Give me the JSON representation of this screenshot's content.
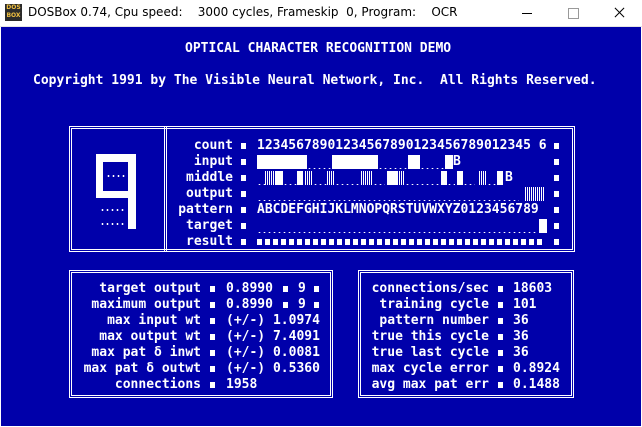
{
  "window": {
    "title": "DOSBox 0.74, Cpu speed:    3000 cycles, Frameskip  0, Program:    OCR",
    "icon_text": "DOS BOX"
  },
  "header": {
    "title": "OPTICAL CHARACTER RECOGNITION DEMO",
    "copyright": "Copyright 1991 by The Visible Neural Network, Inc.  All Rights Reserved."
  },
  "network": {
    "labels": [
      "count",
      "input",
      "middle",
      "output",
      "pattern",
      "target",
      "result"
    ],
    "count": "12345678901234567890123456789012345 6",
    "input_marker": "B",
    "middle_marker": "B",
    "pattern": "ABCDEFGHIJKLMNOPQRSTUVWXYZ0123456789"
  },
  "output_stats": {
    "rows": [
      {
        "label": "target output",
        "value": "0.8990",
        "extra": "9"
      },
      {
        "label": "maximum output",
        "value": "0.8990",
        "extra": "9"
      },
      {
        "label": "max input wt",
        "value": "(+/-) 1.0974",
        "extra": ""
      },
      {
        "label": "max output wt",
        "value": "(+/-) 7.4091",
        "extra": ""
      },
      {
        "label": "max pat δ inwt",
        "value": "(+/-) 0.0081",
        "extra": ""
      },
      {
        "label": "max pat δ outwt",
        "value": "(+/-) 0.5360",
        "extra": ""
      },
      {
        "label": "connections",
        "value": "1958",
        "extra": ""
      }
    ]
  },
  "training_stats": {
    "rows": [
      {
        "label": "connections/sec",
        "value": "18603"
      },
      {
        "label": "training cycle",
        "value": "101"
      },
      {
        "label": "pattern number",
        "value": "36"
      },
      {
        "label": "true this cycle",
        "value": "36"
      },
      {
        "label": "true last cycle",
        "value": "36"
      },
      {
        "label": "max cycle error",
        "value": "0.8924"
      },
      {
        "label": "avg max pat err",
        "value": "0.1488"
      }
    ]
  }
}
